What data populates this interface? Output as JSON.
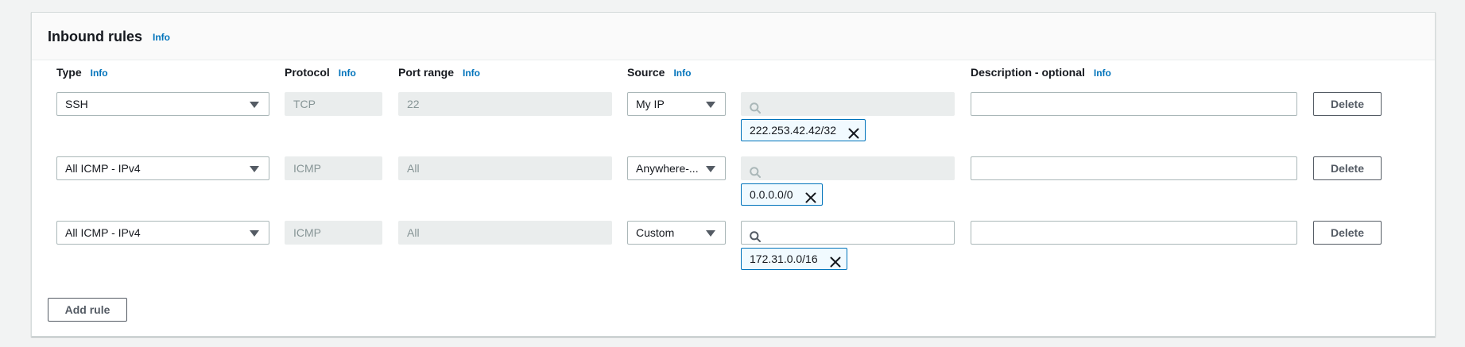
{
  "panel": {
    "title": "Inbound rules",
    "info": "Info"
  },
  "columns": {
    "type": {
      "label": "Type",
      "info": "Info"
    },
    "protocol": {
      "label": "Protocol",
      "info": "Info"
    },
    "port_range": {
      "label": "Port range",
      "info": "Info"
    },
    "source": {
      "label": "Source",
      "info": "Info"
    },
    "description": {
      "label": "Description - optional",
      "info": "Info"
    }
  },
  "rules": [
    {
      "type": "SSH",
      "protocol": "TCP",
      "port_range": "22",
      "source": "My IP",
      "search_value": "",
      "search_enabled": false,
      "token": "222.253.42.42/32",
      "description": "",
      "delete_label": "Delete"
    },
    {
      "type": "All ICMP - IPv4",
      "protocol": "ICMP",
      "port_range": "All",
      "source": "Anywhere-...",
      "search_value": "",
      "search_enabled": false,
      "token": "0.0.0.0/0",
      "description": "",
      "delete_label": "Delete"
    },
    {
      "type": "All ICMP - IPv4",
      "protocol": "ICMP",
      "port_range": "All",
      "source": "Custom",
      "search_value": "",
      "search_enabled": true,
      "token": "172.31.0.0/16",
      "description": "",
      "delete_label": "Delete"
    }
  ],
  "add_rule_label": "Add rule",
  "colors": {
    "link": "#0073bb",
    "token_border": "#0073bb",
    "disabled_bg": "#eaeded",
    "page_bg": "#f2f3f3"
  },
  "icons": {
    "dropdown": "caret-down-icon",
    "search": "search-icon",
    "remove": "close-icon"
  }
}
